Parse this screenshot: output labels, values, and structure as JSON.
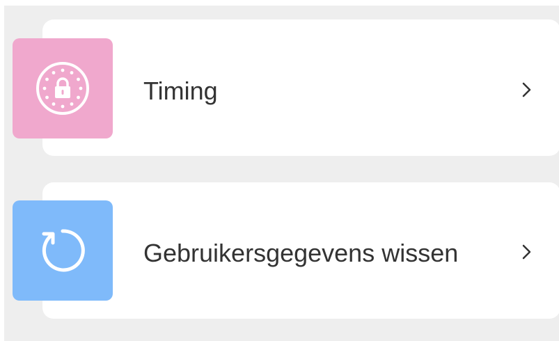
{
  "settings": {
    "items": [
      {
        "label": "Timing",
        "icon": "timer-lock-icon",
        "tile_color": "#F0A8CD",
        "chevron": "chevron-right-icon"
      },
      {
        "label": "Gebruikersgegevens wissen",
        "icon": "reset-icon",
        "tile_color": "#7FBAFA",
        "chevron": "chevron-right-icon"
      }
    ]
  },
  "colors": {
    "background": "#EEEEEE",
    "card": "#FFFFFF",
    "text": "#333333"
  }
}
